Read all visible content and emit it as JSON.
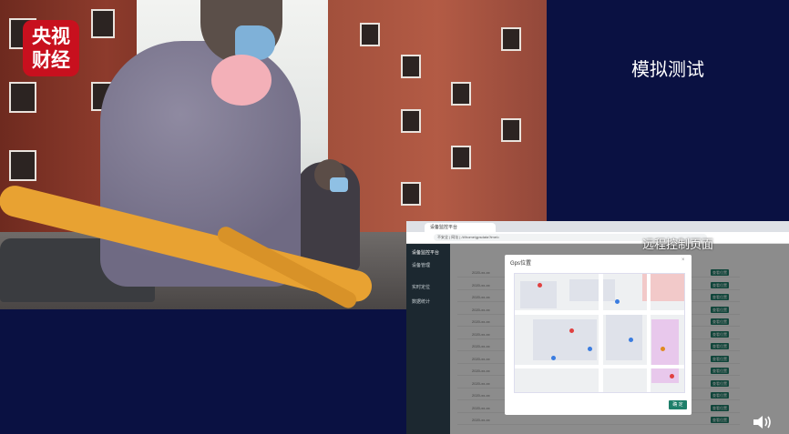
{
  "logo": {
    "line1": "央视",
    "line2": "财经"
  },
  "sim_title": "模拟测试",
  "remote_label": "远程控制页面",
  "browser": {
    "tab_title": "设备监控平台",
    "url": "不安全 | 网址 | /#/home/gpsdata?imei=",
    "sidebar_items": [
      "设备监控平台",
      "设备管理",
      "实时定位",
      "数据统计"
    ],
    "rows": [
      {
        "time": "2020-xx-xx",
        "action": "查看位置"
      },
      {
        "time": "2020-xx-xx",
        "action": "查看位置"
      },
      {
        "time": "2020-xx-xx",
        "action": "查看位置"
      },
      {
        "time": "2020-xx-xx",
        "action": "查看位置"
      },
      {
        "time": "2020-xx-xx",
        "action": "查看位置"
      },
      {
        "time": "2020-xx-xx",
        "action": "查看位置"
      },
      {
        "time": "2020-xx-xx",
        "action": "查看位置"
      },
      {
        "time": "2020-xx-xx",
        "action": "查看位置"
      },
      {
        "time": "2020-xx-xx",
        "action": "查看位置"
      },
      {
        "time": "2020-xx-xx",
        "action": "查看位置"
      },
      {
        "time": "2020-xx-xx",
        "action": "查看位置"
      },
      {
        "time": "2020-xx-xx",
        "action": "查看位置"
      },
      {
        "time": "2020-xx-xx",
        "action": "查看位置"
      }
    ]
  },
  "modal": {
    "title": "Gps位置",
    "close": "×",
    "confirm": "确 定"
  },
  "colors": {
    "background": "#0a1142",
    "accent": "#1e7f6a",
    "logo_red": "#c8101e"
  },
  "icons": [
    "volume-icon",
    "map-pin-icon",
    "close-icon"
  ]
}
